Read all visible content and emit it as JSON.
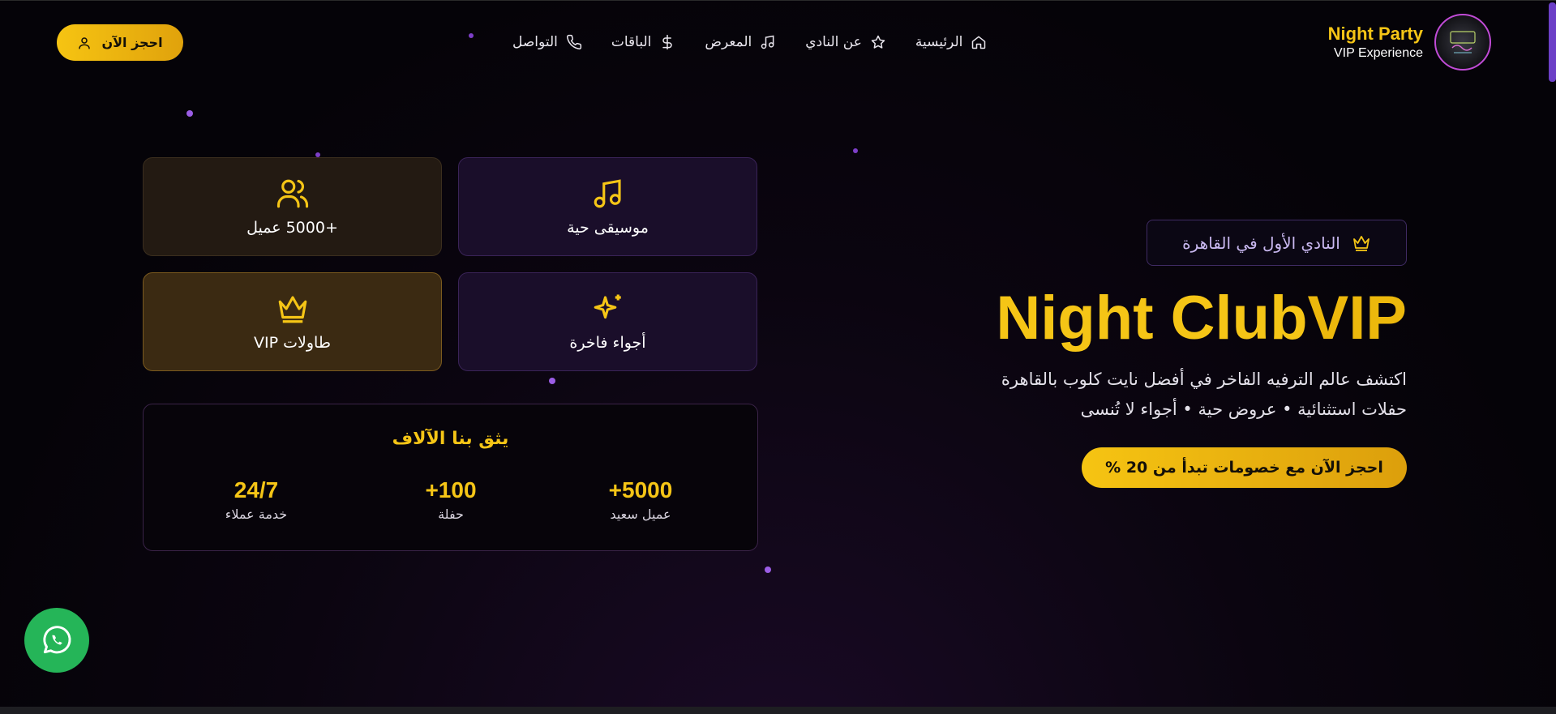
{
  "header": {
    "book_button": "احجز الآن",
    "nav": [
      {
        "label": "الرئيسية",
        "icon": "home-icon"
      },
      {
        "label": "عن النادي",
        "icon": "star-icon"
      },
      {
        "label": "المعرض",
        "icon": "music-icon"
      },
      {
        "label": "الباقات",
        "icon": "dollar-icon"
      },
      {
        "label": "التواصل",
        "icon": "phone-icon"
      }
    ],
    "brand_name": "Night Party",
    "brand_sub": "VIP Experience"
  },
  "features": [
    {
      "label": "موسيقى حية",
      "icon": "music-note-icon"
    },
    {
      "label": "+5000 عميل",
      "icon": "users-icon"
    },
    {
      "label": "أجواء فاخرة",
      "icon": "sparkles-icon"
    },
    {
      "label": "طاولات VIP",
      "icon": "crown-icon"
    }
  ],
  "trust": {
    "title": "يثق بنا الآلاف",
    "stats": [
      {
        "value": "+5000",
        "caption": "عميل سعيد"
      },
      {
        "value": "+100",
        "caption": "حفلة"
      },
      {
        "value": "24/7",
        "caption": "خدمة عملاء"
      }
    ]
  },
  "hero": {
    "badge": "النادي الأول في القاهرة",
    "title_main": "Night Club",
    "title_accent": "VIP",
    "desc_line1": "اكتشف عالم الترفيه الفاخر في أفضل نايت كلوب بالقاهرة",
    "desc_line2": "حفلات استثنائية • عروض حية • أجواء لا تُنسى",
    "cta": "احجز الآن مع خصومات تبدأ من 20 %"
  },
  "colors": {
    "accent": "#f5c516",
    "purple": "#9b5de5",
    "whatsapp": "#25b558"
  }
}
